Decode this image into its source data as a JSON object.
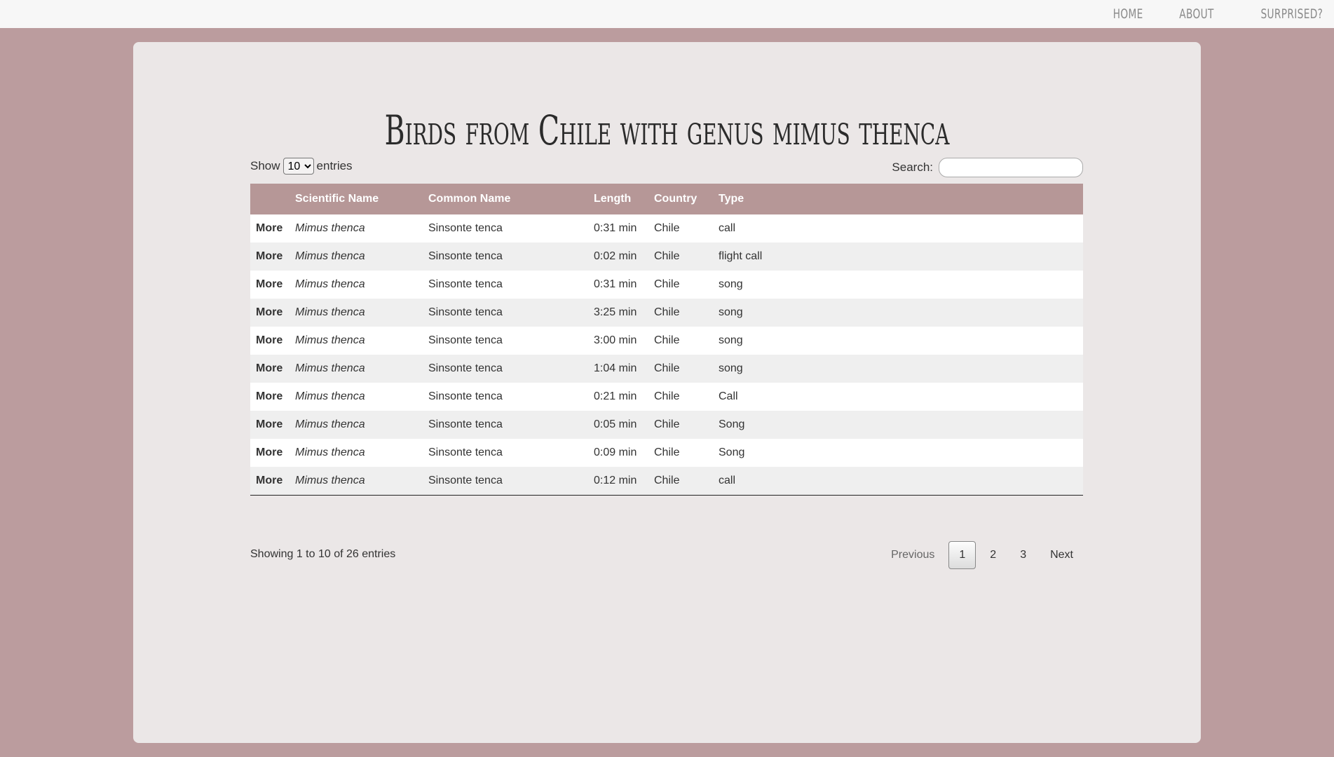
{
  "nav": {
    "links": [
      "HOME",
      "ABOUT",
      "SURPRISED?"
    ]
  },
  "page": {
    "title": "Birds from Chile with genus mimus thenca"
  },
  "controls": {
    "show_label": "Show",
    "length_value": "10",
    "entries_label": "entries",
    "search_label": "Search:",
    "search_value": ""
  },
  "table": {
    "columns": [
      "",
      "Scientific Name",
      "Common Name",
      "Length",
      "Country",
      "Type"
    ],
    "rows": [
      {
        "action": "More",
        "scientific": "Mimus thenca",
        "common": "Sinsonte tenca",
        "length": "0:31 min",
        "country": "Chile",
        "type": "call"
      },
      {
        "action": "More",
        "scientific": "Mimus thenca",
        "common": "Sinsonte tenca",
        "length": "0:02 min",
        "country": "Chile",
        "type": "flight call"
      },
      {
        "action": "More",
        "scientific": "Mimus thenca",
        "common": "Sinsonte tenca",
        "length": "0:31 min",
        "country": "Chile",
        "type": "song"
      },
      {
        "action": "More",
        "scientific": "Mimus thenca",
        "common": "Sinsonte tenca",
        "length": "3:25 min",
        "country": "Chile",
        "type": "song"
      },
      {
        "action": "More",
        "scientific": "Mimus thenca",
        "common": "Sinsonte tenca",
        "length": "3:00 min",
        "country": "Chile",
        "type": "song"
      },
      {
        "action": "More",
        "scientific": "Mimus thenca",
        "common": "Sinsonte tenca",
        "length": "1:04 min",
        "country": "Chile",
        "type": "song"
      },
      {
        "action": "More",
        "scientific": "Mimus thenca",
        "common": "Sinsonte tenca",
        "length": "0:21 min",
        "country": "Chile",
        "type": "Call"
      },
      {
        "action": "More",
        "scientific": "Mimus thenca",
        "common": "Sinsonte tenca",
        "length": "0:05 min",
        "country": "Chile",
        "type": "Song"
      },
      {
        "action": "More",
        "scientific": "Mimus thenca",
        "common": "Sinsonte tenca",
        "length": "0:09 min",
        "country": "Chile",
        "type": "Song"
      },
      {
        "action": "More",
        "scientific": "Mimus thenca",
        "common": "Sinsonte tenca",
        "length": "0:12 min",
        "country": "Chile",
        "type": "call"
      }
    ]
  },
  "footer": {
    "info": "Showing 1 to 10 of 26 entries",
    "previous": "Previous",
    "pages": [
      "1",
      "2",
      "3"
    ],
    "next": "Next"
  },
  "colors": {
    "background": "#bb9c9e",
    "card": "#ebe7e7",
    "header": "#b69797"
  }
}
